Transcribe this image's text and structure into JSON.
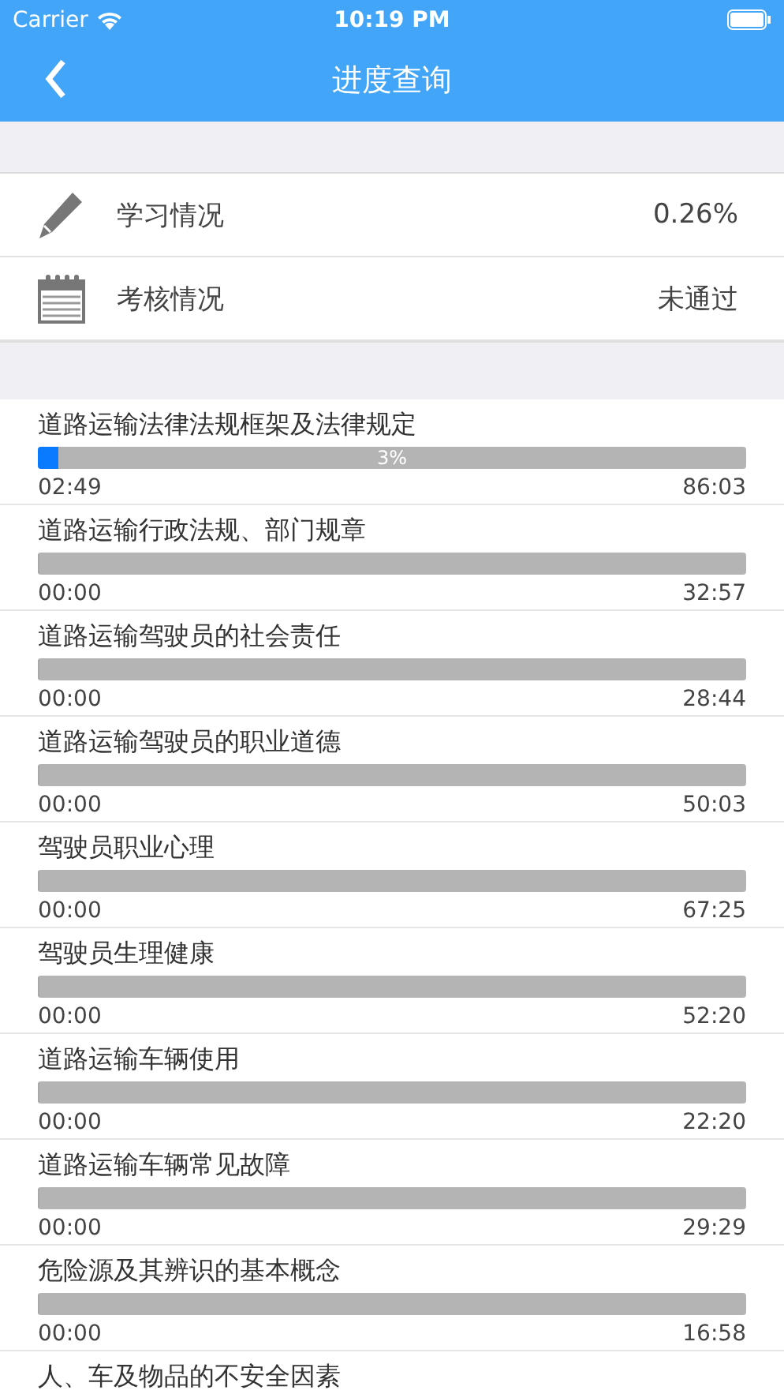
{
  "status_bar": {
    "carrier": "Carrier",
    "time": "10:19 PM"
  },
  "nav": {
    "title": "进度查询"
  },
  "summary": [
    {
      "kind": "pencil",
      "label": "学习情况",
      "value": "0.26%"
    },
    {
      "kind": "notepad",
      "label": "考核情况",
      "value": "未通过"
    }
  ],
  "courses": [
    {
      "title": "道路运输法律法规框架及法律规定",
      "level": 0.03,
      "percent": "3%",
      "elapsed": "02:49",
      "total": "86:03"
    },
    {
      "title": "道路运输行政法规、部门规章",
      "level": 0,
      "elapsed": "00:00",
      "total": "32:57"
    },
    {
      "title": "道路运输驾驶员的社会责任",
      "level": 0,
      "elapsed": "00:00",
      "total": "28:44"
    },
    {
      "title": "道路运输驾驶员的职业道德",
      "level": 0,
      "elapsed": "00:00",
      "total": "50:03"
    },
    {
      "title": "驾驶员职业心理",
      "level": 0,
      "elapsed": "00:00",
      "total": "67:25"
    },
    {
      "title": "驾驶员生理健康",
      "level": 0,
      "elapsed": "00:00",
      "total": "52:20"
    },
    {
      "title": "道路运输车辆使用",
      "level": 0,
      "elapsed": "00:00",
      "total": "22:20"
    },
    {
      "title": "道路运输车辆常见故障",
      "level": 0,
      "elapsed": "00:00",
      "total": "29:29"
    },
    {
      "title": "危险源及其辨识的基本概念",
      "level": 0,
      "elapsed": "00:00",
      "total": "16:58"
    },
    {
      "title": "人、车及物品的不安全因素"
    }
  ]
}
